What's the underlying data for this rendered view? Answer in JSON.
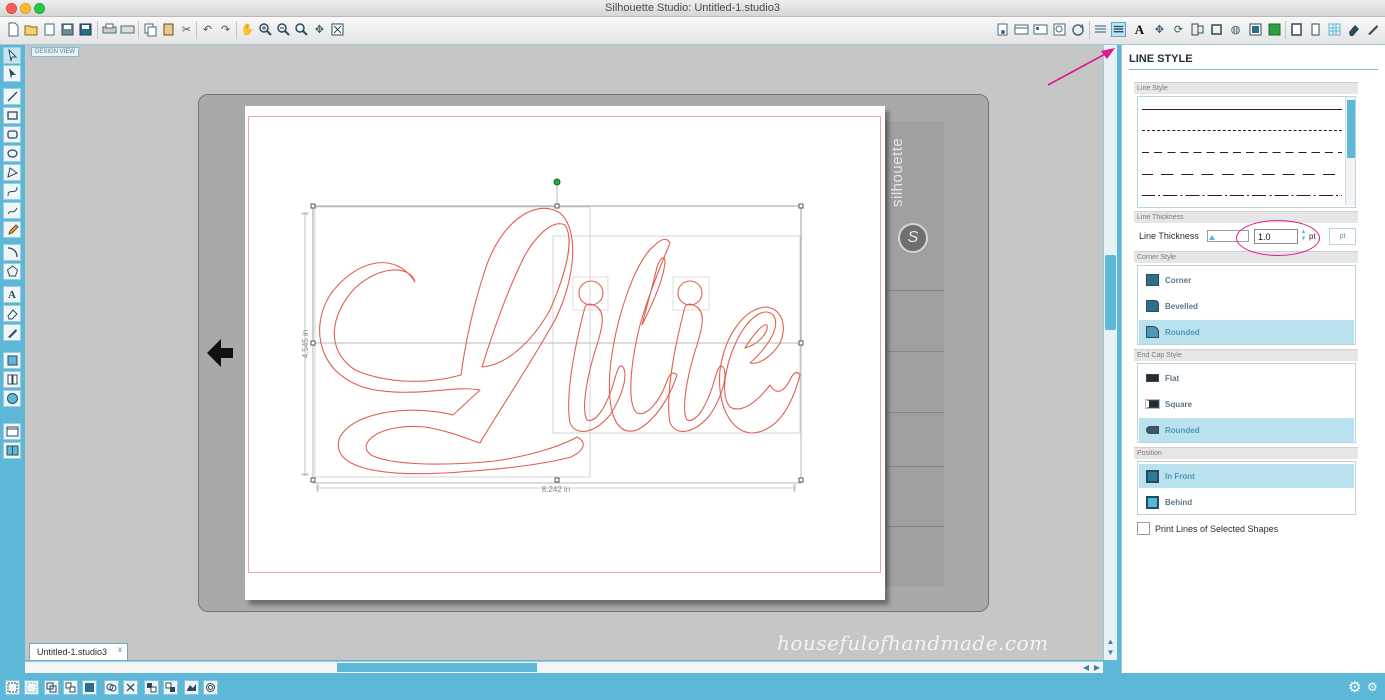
{
  "window": {
    "title": "Silhouette Studio: Untitled-1.studio3"
  },
  "workspace": {
    "view_label": "DESIGN VIEW",
    "mat_brand": "silhouette",
    "mat_logo": "S",
    "design_text": "Lilie",
    "height_dimension": "4.545 in",
    "width_dimension": "8.242 in",
    "watermark": "housefulofhandmade.com"
  },
  "panel": {
    "title": "LINE STYLE",
    "line_style_header": "Line Style",
    "line_thickness_header": "Line Thickness",
    "line_thickness_label": "Line Thickness",
    "line_thickness_value": "1.0",
    "line_thickness_unit": "pt",
    "unit_button": "pt",
    "corner_style_header": "Corner Style",
    "corner_options": [
      "Corner",
      "Bevelled",
      "Rounded"
    ],
    "corner_selected": "Rounded",
    "end_cap_header": "End Cap Style",
    "end_cap_options": [
      "Flat",
      "Square",
      "Rounded"
    ],
    "end_cap_selected": "Rounded",
    "position_header": "Position",
    "position_options": [
      "In Front",
      "Behind"
    ],
    "position_selected": "In Front",
    "print_lines_label": "Print Lines of Selected Shapes"
  },
  "tabs": {
    "document": "Untitled-1.studio3",
    "close": "x"
  },
  "colors": {
    "app_blue": "#5cb8d6",
    "cut_line": "#e06050",
    "annotation_pink": "#e0178e",
    "selection_green": "#2ea043"
  },
  "icons": {
    "close_glyph": "✕",
    "settings_glyph": "⚙"
  }
}
